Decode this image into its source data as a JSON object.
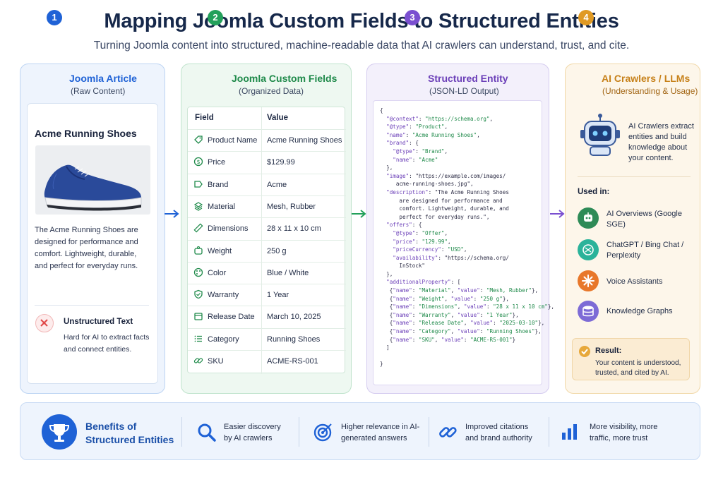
{
  "header": {
    "title": "Mapping Joomla Custom Fields to Structured Entities",
    "subtitle": "Turning Joomla content into structured, machine-readable data that AI crawlers can understand, trust, and cite."
  },
  "panels": {
    "article": {
      "number": "1",
      "title": "Joomla Article",
      "subtitle": "(Raw Content)",
      "product_title": "Acme Running Shoes",
      "description": "The Acme Running Shoes are designed for performance and comfort. Lightweight, durable, and perfect for everyday runs.",
      "unstructured_title": "Unstructured Text",
      "unstructured_text": "Hard for AI to extract facts and connect entities.",
      "color": "#1f62d6"
    },
    "fields": {
      "number": "2",
      "title": "Joomla Custom Fields",
      "subtitle": "(Organized Data)",
      "col_field": "Field",
      "col_value": "Value",
      "rows": [
        {
          "field": "Product Name",
          "value": "Acme Running Shoes",
          "icon": "tag-icon"
        },
        {
          "field": "Price",
          "value": "$129.99",
          "icon": "dollar-icon"
        },
        {
          "field": "Brand",
          "value": "Acme",
          "icon": "label-icon"
        },
        {
          "field": "Material",
          "value": "Mesh, Rubber",
          "icon": "layers-icon"
        },
        {
          "field": "Dimensions",
          "value": "28 x 11 x 10 cm",
          "icon": "ruler-icon"
        },
        {
          "field": "Weight",
          "value": "250 g",
          "icon": "weight-icon"
        },
        {
          "field": "Color",
          "value": "Blue / White",
          "icon": "palette-icon"
        },
        {
          "field": "Warranty",
          "value": "1 Year",
          "icon": "shield-icon"
        },
        {
          "field": "Release Date",
          "value": "March 10, 2025",
          "icon": "calendar-icon"
        },
        {
          "field": "Category",
          "value": "Running Shoes",
          "icon": "list-icon"
        },
        {
          "field": "SKU",
          "value": "ACME-RS-001",
          "icon": "link-icon"
        }
      ],
      "color": "#23a05a"
    },
    "entity": {
      "number": "3",
      "title": "Structured Entity",
      "subtitle": "(JSON-LD Output)",
      "code_lines": [
        "{",
        "  \"@context\": \"https://schema.org\",",
        "  \"@type\": \"Product\",",
        "  \"name\": \"Acme Running Shoes\",",
        "  \"brand\": {",
        "    \"@type\": \"Brand\",",
        "    \"name\": \"Acme\"",
        "  },",
        "  \"image\": \"https://example.com/images/",
        "     acme-running-shoes.jpg\",",
        "  \"description\": \"The Acme Running Shoes",
        "      are designed for performance and",
        "      comfort. Lightweight, durable, and",
        "      perfect for everyday runs.\",",
        "  \"offers\": {",
        "    \"@type\": \"Offer\",",
        "    \"price\": \"129.99\",",
        "    \"priceCurrency\": \"USD\",",
        "    \"availability\": \"https://schema.org/",
        "      InStock\"",
        "  },",
        "  \"additionalProperty\": [",
        "   {\"name\": \"Material\", \"value\": \"Mesh, Rubber\"},",
        "   {\"name\": \"Weight\", \"value\": \"250 g\"},",
        "   {\"name\": \"Dimensions\", \"value\": \"28 x 11 x 10 cm\"},",
        "   {\"name\": \"Warranty\", \"value\": \"1 Year\"},",
        "   {\"name\": \"Release Date\", \"value\": \"2025-03-10\"},",
        "   {\"name\": \"Category\", \"value\": \"Running Shoes\"},",
        "   {\"name\": \"SKU\", \"value\": \"ACME-RS-001\"}",
        "  ]",
        "",
        "}"
      ],
      "color": "#7a4fd0"
    },
    "crawlers": {
      "number": "4",
      "title": "AI Crawlers / LLMs",
      "subtitle": "(Understanding & Usage)",
      "crawler_text": "AI Crawlers extract entities and build knowledge about your content.",
      "used_in_label": "Used in:",
      "uses": [
        {
          "label": "AI Overviews (Google SGE)",
          "icon": "ai-overviews-icon",
          "color": "#2e8b57"
        },
        {
          "label": "ChatGPT / Bing Chat / Perplexity",
          "icon": "chatgpt-icon",
          "color": "#2bb39a"
        },
        {
          "label": "Voice Assistants",
          "icon": "voice-assistant-icon",
          "color": "#e8772a"
        },
        {
          "label": "Knowledge Graphs",
          "icon": "database-icon",
          "color": "#7d6bd6"
        }
      ],
      "result_title": "Result:",
      "result_text": "Your content is understood, trusted, and cited by AI.",
      "color": "#e09a24"
    }
  },
  "benefits": {
    "title": "Benefits of Structured Entities",
    "items": [
      {
        "text": "Easier discovery by AI crawlers",
        "icon": "search-icon"
      },
      {
        "text": "Higher relevance in AI-generated answers",
        "icon": "target-icon"
      },
      {
        "text": "Improved citations and brand authority",
        "icon": "link-icon"
      },
      {
        "text": "More visibility, more traffic, more trust",
        "icon": "bar-chart-icon"
      }
    ]
  }
}
